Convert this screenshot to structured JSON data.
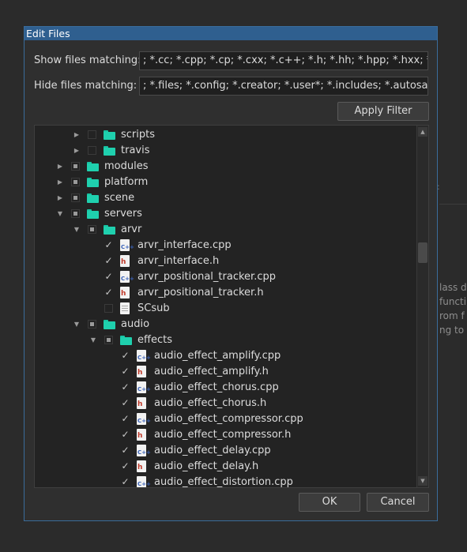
{
  "background_text": [
    "lass d",
    "functi",
    "rom f",
    "ng to s"
  ],
  "dialog": {
    "title": "Edit Files",
    "show_label": "Show files matching:",
    "show_value": "; *.cc; *.cpp; *.cp; *.cxx; *.c++; *.h; *.hh; *.hpp; *.hxx; *.py;",
    "hide_label": "Hide files matching:",
    "hide_value": "; *.files; *.config; *.creator; *.user*; *.includes; *.autosave",
    "apply_filter": "Apply Filter",
    "ok": "OK",
    "cancel": "Cancel"
  },
  "tree": [
    {
      "label": "scripts",
      "type": "folder",
      "depth": 2,
      "expander": "collapsed",
      "check": "unchecked"
    },
    {
      "label": "travis",
      "type": "folder",
      "depth": 2,
      "expander": "collapsed",
      "check": "unchecked"
    },
    {
      "label": "modules",
      "type": "folder",
      "depth": 1,
      "expander": "collapsed",
      "check": "partial"
    },
    {
      "label": "platform",
      "type": "folder",
      "depth": 1,
      "expander": "collapsed",
      "check": "partial"
    },
    {
      "label": "scene",
      "type": "folder",
      "depth": 1,
      "expander": "collapsed",
      "check": "partial"
    },
    {
      "label": "servers",
      "type": "folder",
      "depth": 1,
      "expander": "expanded",
      "check": "partial"
    },
    {
      "label": "arvr",
      "type": "folder",
      "depth": 2,
      "expander": "expanded",
      "check": "partial"
    },
    {
      "label": "arvr_interface.cpp",
      "type": "cpp",
      "depth": 3,
      "expander": "none",
      "check": "checked"
    },
    {
      "label": "arvr_interface.h",
      "type": "h",
      "depth": 3,
      "expander": "none",
      "check": "checked"
    },
    {
      "label": "arvr_positional_tracker.cpp",
      "type": "cpp",
      "depth": 3,
      "expander": "none",
      "check": "checked"
    },
    {
      "label": "arvr_positional_tracker.h",
      "type": "h",
      "depth": 3,
      "expander": "none",
      "check": "checked"
    },
    {
      "label": "SCsub",
      "type": "txt",
      "depth": 3,
      "expander": "none",
      "check": "unchecked"
    },
    {
      "label": "audio",
      "type": "folder",
      "depth": 2,
      "expander": "expanded",
      "check": "partial"
    },
    {
      "label": "effects",
      "type": "folder",
      "depth": 3,
      "expander": "expanded",
      "check": "partial"
    },
    {
      "label": "audio_effect_amplify.cpp",
      "type": "cpp",
      "depth": 4,
      "expander": "none",
      "check": "checked"
    },
    {
      "label": "audio_effect_amplify.h",
      "type": "h",
      "depth": 4,
      "expander": "none",
      "check": "checked"
    },
    {
      "label": "audio_effect_chorus.cpp",
      "type": "cpp",
      "depth": 4,
      "expander": "none",
      "check": "checked"
    },
    {
      "label": "audio_effect_chorus.h",
      "type": "h",
      "depth": 4,
      "expander": "none",
      "check": "checked"
    },
    {
      "label": "audio_effect_compressor.cpp",
      "type": "cpp",
      "depth": 4,
      "expander": "none",
      "check": "checked"
    },
    {
      "label": "audio_effect_compressor.h",
      "type": "h",
      "depth": 4,
      "expander": "none",
      "check": "checked"
    },
    {
      "label": "audio_effect_delay.cpp",
      "type": "cpp",
      "depth": 4,
      "expander": "none",
      "check": "checked"
    },
    {
      "label": "audio_effect_delay.h",
      "type": "h",
      "depth": 4,
      "expander": "none",
      "check": "checked"
    },
    {
      "label": "audio_effect_distortion.cpp",
      "type": "cpp",
      "depth": 4,
      "expander": "none",
      "check": "checked"
    }
  ],
  "colors": {
    "titlebar": "#2f5f8f",
    "folder": "#1fd0ae"
  }
}
